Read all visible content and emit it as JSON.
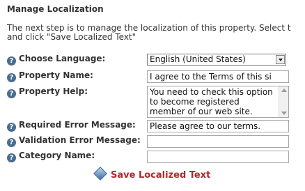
{
  "heading": "Manage Localization",
  "intro": {
    "line1": "The next step is to manage the localization of this property. Select t",
    "line2": "and click \"Save Localized Text\""
  },
  "help_icon_glyph": "?",
  "fields": {
    "language": {
      "label": "Choose Language:",
      "value": "English (United States)"
    },
    "property_name": {
      "label": "Property Name:",
      "value": "I agree to the Terms of this si"
    },
    "property_help": {
      "label": "Property Help:",
      "value": "You need to check this option to become registered member of our web site."
    },
    "required_error": {
      "label": "Required Error Message:",
      "value": "Please agree to our terms."
    },
    "validation_error": {
      "label": "Validation Error Message:",
      "value": ""
    },
    "category_name": {
      "label": "Category Name:",
      "value": ""
    }
  },
  "save_label": "Save Localized Text",
  "icons": {
    "help": "help-icon",
    "save": "save-diamond-icon"
  },
  "colors": {
    "save_text": "#b5252c",
    "help_icon": "#4a6d8e"
  }
}
